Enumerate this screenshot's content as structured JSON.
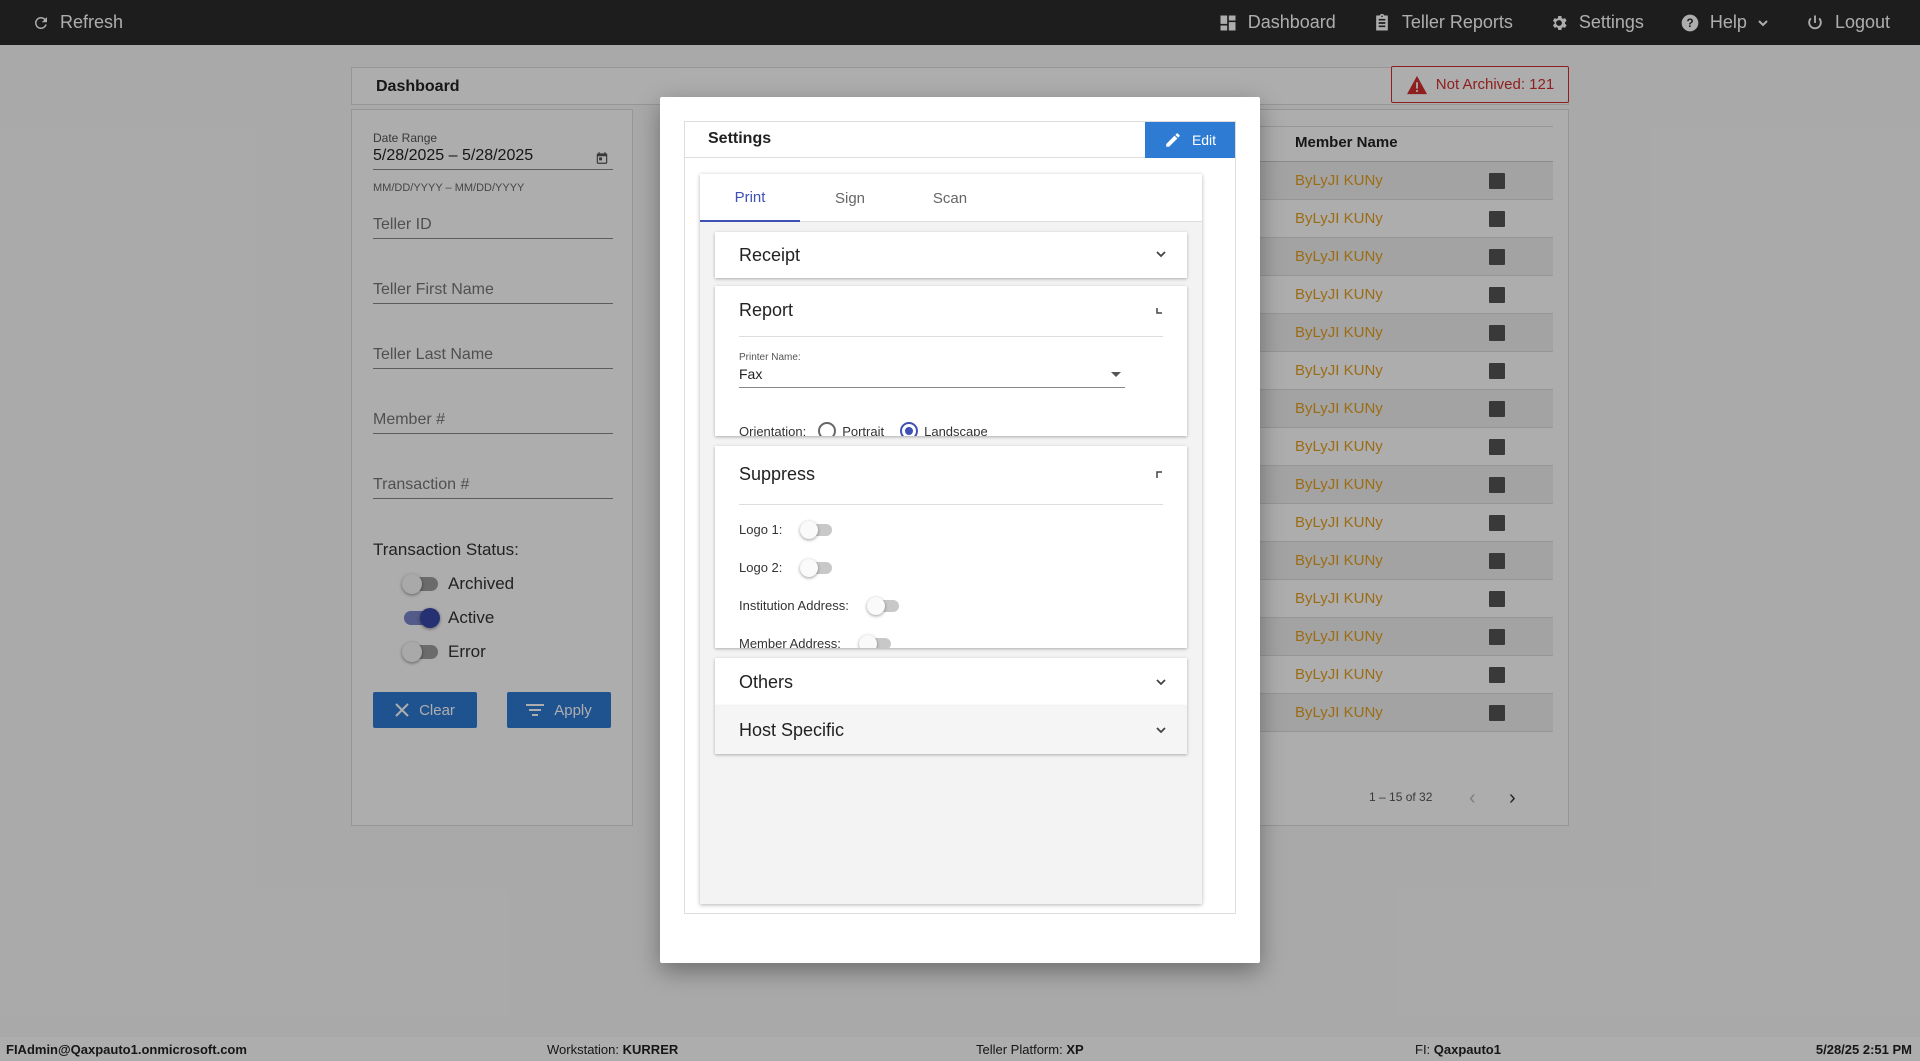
{
  "topbar": {
    "refresh_label": "Refresh",
    "nav": {
      "dashboard": "Dashboard",
      "teller_reports": "Teller Reports",
      "settings": "Settings",
      "help": "Help",
      "logout": "Logout"
    }
  },
  "dashboard": {
    "title": "Dashboard",
    "not_archived_label": "Not Archived: 121"
  },
  "filters": {
    "date_range_label": "Date Range",
    "date_range_value": "5/28/2025 – 5/28/2025",
    "date_hint": "MM/DD/YYYY – MM/DD/YYYY",
    "teller_id": "Teller ID",
    "teller_first_name": "Teller First Name",
    "teller_last_name": "Teller Last Name",
    "member_number": "Member #",
    "transaction_number": "Transaction #",
    "status_title": "Transaction Status:",
    "statuses": [
      {
        "label": "Archived",
        "on": false
      },
      {
        "label": "Active",
        "on": true
      },
      {
        "label": "Error",
        "on": false
      }
    ],
    "clear_label": "Clear",
    "apply_label": "Apply"
  },
  "table": {
    "column_member_name": "Member Name",
    "rows": [
      "ByLyJI KUNy",
      "ByLyJI KUNy",
      "ByLyJI KUNy",
      "ByLyJI KUNy",
      "ByLyJI KUNy",
      "ByLyJI KUNy",
      "ByLyJI KUNy",
      "ByLyJI KUNy",
      "ByLyJI KUNy",
      "ByLyJI KUNy",
      "ByLyJI KUNy",
      "ByLyJI KUNy",
      "ByLyJI KUNy",
      "ByLyJI KUNy",
      "ByLyJI KUNy"
    ],
    "pagination": "1 – 15 of 32"
  },
  "statusbar": {
    "user": "FIAdmin@Qaxpauto1.onmicrosoft.com",
    "workstation_label": "Workstation:",
    "workstation_value": "KURRER",
    "platform_label": "Teller Platform:",
    "platform_value": "XP",
    "fi_label": "FI:",
    "fi_value": "Qaxpauto1",
    "datetime": "5/28/25 2:51 PM"
  },
  "settings_modal": {
    "title": "Settings",
    "edit_label": "Edit",
    "tabs": [
      "Print",
      "Sign",
      "Scan"
    ],
    "active_tab": "Print",
    "sections": {
      "receipt": "Receipt",
      "report": "Report",
      "suppress": "Suppress",
      "others": "Others",
      "host_specific": "Host Specific"
    },
    "report": {
      "printer_name_label": "Printer Name:",
      "printer_name_value": "Fax",
      "orientation_label": "Orientation:",
      "portrait_label": "Portrait",
      "landscape_label": "Landscape",
      "orientation_selected": "Landscape"
    },
    "suppress": {
      "items": [
        {
          "label": "Logo 1:",
          "on": false
        },
        {
          "label": "Logo 2:",
          "on": false
        },
        {
          "label": "Institution Address:",
          "on": false
        },
        {
          "label": "Member Address:",
          "on": false
        }
      ]
    }
  },
  "colors": {
    "topbar": "#2b2b2b",
    "accent_blue": "#2e7bd4",
    "indigo": "#3f51b5",
    "error_red": "#d32f2f",
    "member_name": "#e6a020"
  }
}
